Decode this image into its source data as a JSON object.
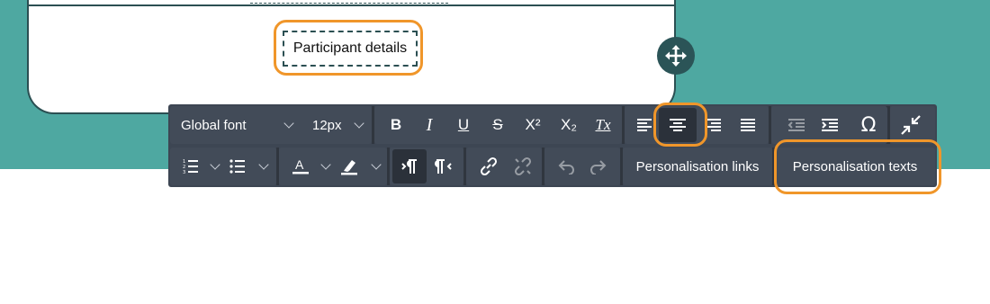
{
  "canvas": {
    "placeholder_label": "Participant details"
  },
  "toolbar": {
    "font_family": "Global font",
    "font_size": "12px",
    "bold": "B",
    "italic": "I",
    "underline": "U",
    "strikethrough": "S",
    "superscript": "X²",
    "subscript": "X₂",
    "clear_format": "Tx",
    "special_char": "Ω",
    "personalisation_links": "Personalisation links",
    "personalisation_texts": "Personalisation texts",
    "active_alignment": "center"
  },
  "colors": {
    "teal_background": "#4ea8a1",
    "toolbar_bg": "#3d4653",
    "highlight": "#f0962a",
    "dark_teal": "#2b5457"
  }
}
